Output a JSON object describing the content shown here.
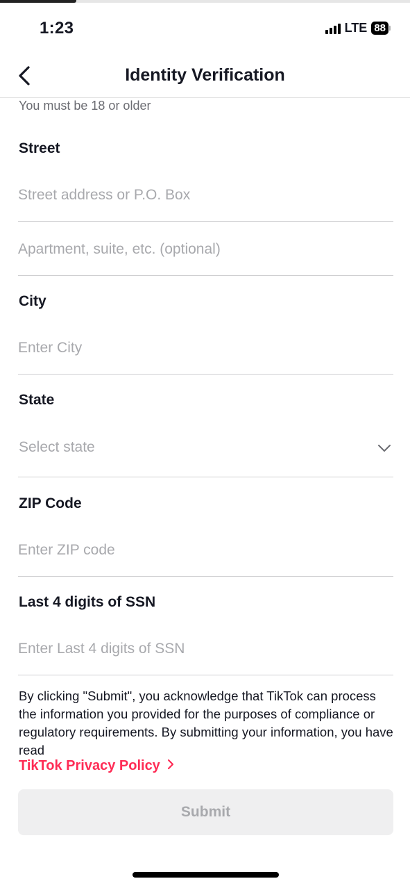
{
  "status_bar": {
    "time": "1:23",
    "network": "LTE",
    "battery": "88"
  },
  "header": {
    "title": "Identity Verification",
    "back_icon": "chevron-left-icon"
  },
  "form": {
    "age_note": "You must be 18 or older",
    "street": {
      "label": "Street",
      "line1_placeholder": "Street address or P.O. Box",
      "line2_placeholder": "Apartment, suite, etc. (optional)"
    },
    "city": {
      "label": "City",
      "placeholder": "Enter City"
    },
    "state": {
      "label": "State",
      "placeholder": "Select state",
      "icon": "chevron-down-icon"
    },
    "zip": {
      "label": "ZIP Code",
      "placeholder": "Enter ZIP code"
    },
    "ssn": {
      "label": "Last 4 digits of SSN",
      "placeholder": "Enter Last 4 digits of SSN"
    }
  },
  "footer": {
    "disclaimer": "By clicking \"Submit\", you acknowledge that TikTok can process the information you provided for the purposes of compliance or regulatory requirements. By submitting your information, you have read",
    "privacy_link": "TikTok Privacy Policy",
    "privacy_link_icon": "chevron-right-icon",
    "submit_label": "Submit"
  },
  "colors": {
    "link": "#fe2c55",
    "placeholder": "#a8a9ad",
    "button_disabled_bg": "#efeff0",
    "divider": "#cfcfd1"
  }
}
